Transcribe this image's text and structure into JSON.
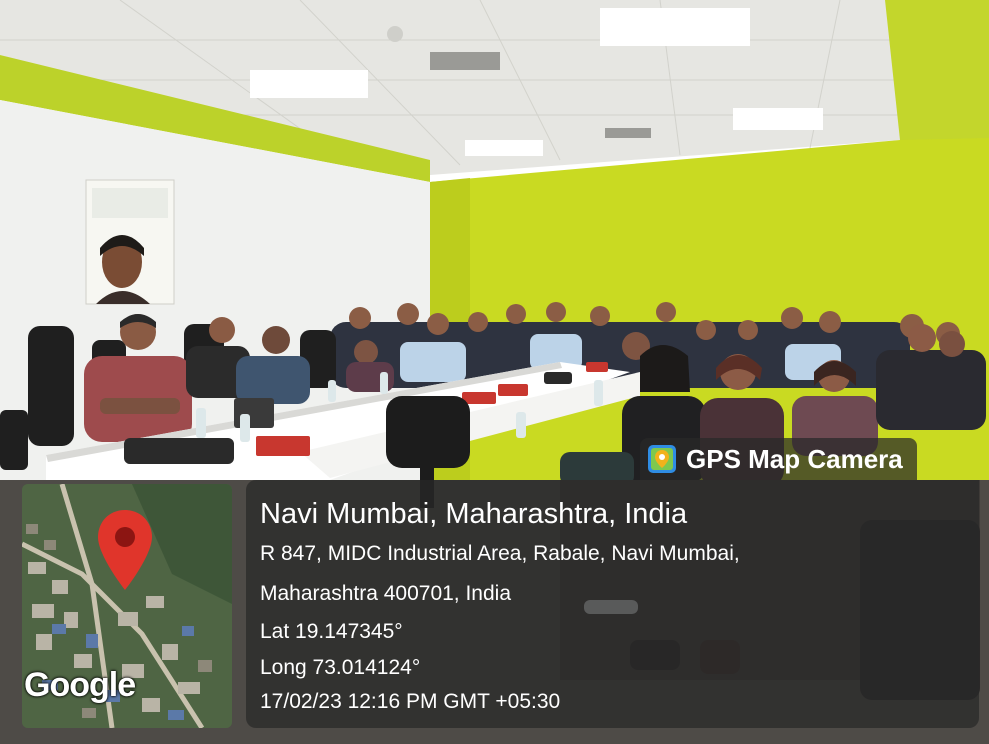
{
  "image": {
    "kind": "photograph",
    "scene": "group photo in a conference room with a long white table, black office chairs, lime green accent wall and a framed portrait on the white wall"
  },
  "badge": {
    "label": "GPS Map Camera",
    "icon": "map-pin-app-icon"
  },
  "location": {
    "title": "Navi Mumbai, Maharashtra, India",
    "address_line1": "R 847, MIDC Industrial Area, Rabale, Navi Mumbai,",
    "address_line2": "Maharashtra 400701, India",
    "lat": "Lat 19.147345°",
    "long": "Long 73.014124°",
    "datetime": "17/02/23 12:16 PM GMT +05:30"
  },
  "map": {
    "provider": "Google",
    "marker": "red-location-pin-icon"
  },
  "colors": {
    "wall_accent": "#c8d820",
    "overlay": "#282828",
    "pin": "#e0352b"
  }
}
